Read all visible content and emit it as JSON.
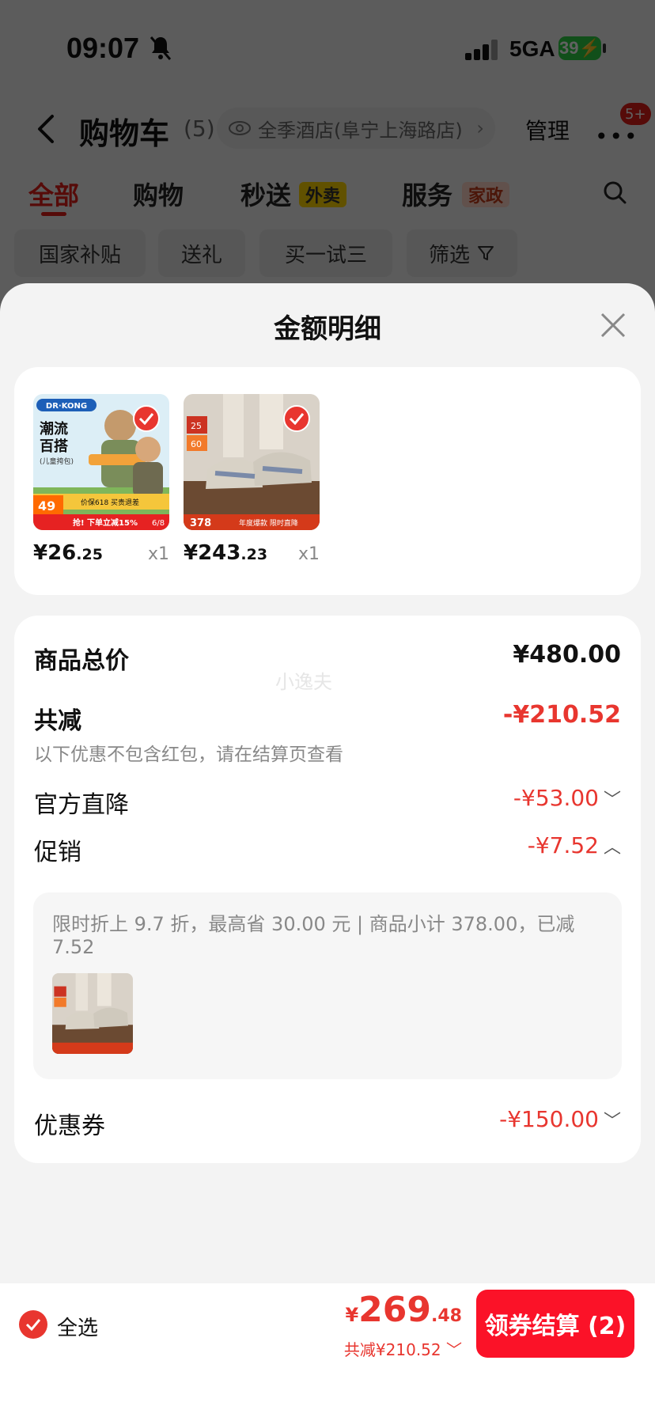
{
  "status_bar": {
    "time": "09:07",
    "network": "5GA",
    "battery": "39"
  },
  "nav": {
    "title": "购物车",
    "count": "(5)",
    "store": "全季酒店(阜宁上海路店)",
    "manage": "管理",
    "badge": "5+"
  },
  "tabs": [
    {
      "label": "全部"
    },
    {
      "label": "购物"
    },
    {
      "label": "秒送",
      "tag": "外卖"
    },
    {
      "label": "服务",
      "tag": "家政"
    }
  ],
  "filters": [
    "国家补贴",
    "送礼",
    "买一试三",
    "筛选"
  ],
  "sheet": {
    "title": "金额明细",
    "products": [
      {
        "price_main": "¥26",
        "price_dec": ".25",
        "qty": "x1",
        "image_text": {
          "brand": "DR·KONG",
          "line1": "潮流",
          "line2": "百搭",
          "sub": "(儿童挎包)",
          "promo": "价保618 买贵退差",
          "price": "49",
          "banner": "抢! 下单立减15%",
          "date": "6/8"
        }
      },
      {
        "price_main": "¥243",
        "price_dec": ".23",
        "qty": "x1",
        "image_text": {
          "n1": "25",
          "n2": "60",
          "price": "378",
          "banner": "年度爆款 限时直降"
        }
      }
    ],
    "summary": {
      "total_label": "商品总价",
      "total_value": "¥480.00",
      "watermark": "小逸夫",
      "reduce_label": "共减",
      "reduce_value": "-¥210.52",
      "reduce_note": "以下优惠不包含红包，请在结算页查看",
      "official_label": "官方直降",
      "official_value": "-¥53.00",
      "promo_label": "促销",
      "promo_value": "-¥7.52",
      "promo_detail": "限时折上 9.7 折，最高省 30.00 元 | 商品小计 378.00，已减 7.52",
      "coupon_label": "优惠券",
      "coupon_value": "-¥150.00"
    }
  },
  "bottom": {
    "select_all": "全选",
    "price_symbol": "¥",
    "price_main": "269",
    "price_dec": ".48",
    "discount": "共减¥210.52",
    "checkout": "领券结算 (2)"
  },
  "colors": {
    "accent": "#e8362f",
    "checkout": "#fb1228",
    "sheet_bg": "#f3f3f3"
  }
}
